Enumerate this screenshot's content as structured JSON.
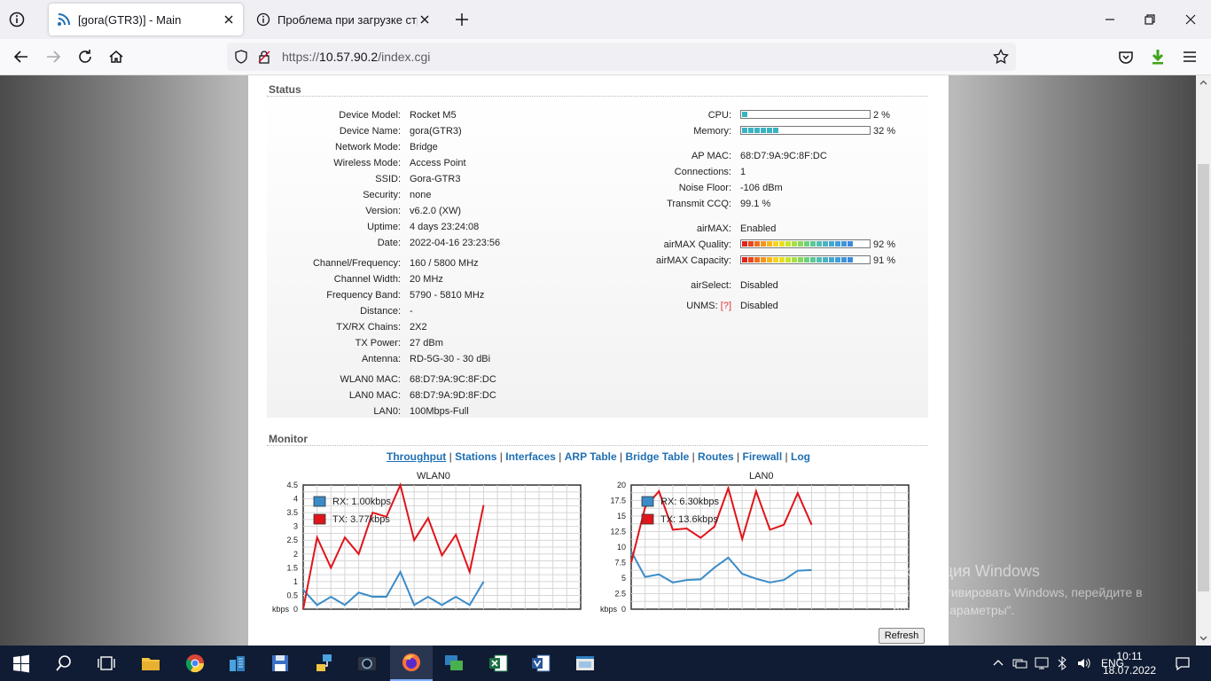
{
  "browser": {
    "tabs": [
      {
        "title": "[gora(GTR3)] - Main",
        "active": true
      },
      {
        "title": "Проблема при загрузке стран",
        "active": false
      }
    ],
    "url_prefix": "https://",
    "url_host": "10.57.90.2",
    "url_path": "/index.cgi"
  },
  "status": {
    "title": "Status",
    "left": [
      {
        "label": "Device Model:",
        "value": "Rocket M5"
      },
      {
        "label": "Device Name:",
        "value": "gora(GTR3)"
      },
      {
        "label": "Network Mode:",
        "value": "Bridge"
      },
      {
        "label": "Wireless Mode:",
        "value": "Access Point"
      },
      {
        "label": "SSID:",
        "value": "Gora-GTR3"
      },
      {
        "label": "Security:",
        "value": "none"
      },
      {
        "label": "Version:",
        "value": "v6.2.0 (XW)"
      },
      {
        "label": "Uptime:",
        "value": "4 days 23:24:08"
      },
      {
        "label": "Date:",
        "value": "2022-04-16 23:23:56"
      },
      {
        "label": "Channel/Frequency:",
        "value": "160 / 5800 MHz"
      },
      {
        "label": "Channel Width:",
        "value": "20 MHz"
      },
      {
        "label": "Frequency Band:",
        "value": "5790 - 5810 MHz"
      },
      {
        "label": "Distance:",
        "value": "-"
      },
      {
        "label": "TX/RX Chains:",
        "value": "2X2"
      },
      {
        "label": "TX Power:",
        "value": "27 dBm"
      },
      {
        "label": "Antenna:",
        "value": "RD-5G-30 - 30 dBi"
      },
      {
        "label": "WLAN0 MAC:",
        "value": "68:D7:9A:9C:8F:DC"
      },
      {
        "label": "LAN0 MAC:",
        "value": "68:D7:9A:9D:8F:DC"
      },
      {
        "label": "LAN0:",
        "value": "100Mbps-Full"
      }
    ],
    "cpu": {
      "label": "CPU:",
      "value": "2 %",
      "percent": 2
    },
    "memory": {
      "label": "Memory:",
      "value": "32 %",
      "percent": 32
    },
    "right": [
      {
        "label": "AP MAC:",
        "value": "68:D7:9A:9C:8F:DC"
      },
      {
        "label": "Connections:",
        "value": "1"
      },
      {
        "label": "Noise Floor:",
        "value": "-106 dBm"
      },
      {
        "label": "Transmit CCQ:",
        "value": "99.1 %"
      },
      {
        "label": "airMAX:",
        "value": "Enabled"
      }
    ],
    "airmax_quality": {
      "label": "airMAX Quality:",
      "value": "92 %",
      "percent": 92
    },
    "airmax_capacity": {
      "label": "airMAX Capacity:",
      "value": "91 %",
      "percent": 91
    },
    "airselect": {
      "label": "airSelect:",
      "value": "Disabled"
    },
    "unms": {
      "label": "UNMS:",
      "help": "[?]",
      "value": "Disabled"
    }
  },
  "monitor": {
    "title": "Monitor",
    "links": [
      "Throughput",
      "Stations",
      "Interfaces",
      "ARP Table",
      "Bridge Table",
      "Routes",
      "Firewall",
      "Log"
    ],
    "current_link": "Throughput",
    "refresh_label": "Refresh"
  },
  "chart_data": [
    {
      "type": "line",
      "title": "WLAN0",
      "ylabel": "kbps",
      "ylim": [
        0,
        4.5
      ],
      "yticks": [
        "4.5",
        "4",
        "3.5",
        "3",
        "2.5",
        "2",
        "1.5",
        "1",
        "0.5",
        "0"
      ],
      "series": [
        {
          "name": "RX: 1.00kbps",
          "color": "#3a8cc8",
          "values": [
            0.7,
            0.15,
            0.45,
            0.15,
            0.6,
            0.45,
            0.45,
            1.35,
            0.15,
            0.45,
            0.15,
            0.45,
            0.15,
            1.0
          ]
        },
        {
          "name": "TX: 3.77kbps",
          "color": "#e0151b",
          "values": [
            0.0,
            2.6,
            1.5,
            2.6,
            2.0,
            3.5,
            3.35,
            4.5,
            2.5,
            3.3,
            1.95,
            2.7,
            1.35,
            3.77
          ]
        }
      ]
    },
    {
      "type": "line",
      "title": "LAN0",
      "ylabel": "kbps",
      "ylim": [
        0,
        20
      ],
      "yticks": [
        "20",
        "17.5",
        "15",
        "12.5",
        "10",
        "7.5",
        "5",
        "2.5",
        "0"
      ],
      "series": [
        {
          "name": "RX: 6.30kbps",
          "color": "#3a8cc8",
          "values": [
            9.3,
            5.2,
            5.6,
            4.3,
            4.7,
            4.8,
            6.7,
            8.3,
            5.7,
            4.9,
            4.3,
            4.7,
            6.2,
            6.3
          ]
        },
        {
          "name": "TX: 13.6kbps",
          "color": "#e0151b",
          "values": [
            7.5,
            16.4,
            19.0,
            12.8,
            13.0,
            11.5,
            13.3,
            19.5,
            11.3,
            19.0,
            12.8,
            13.6,
            18.7,
            13.6
          ]
        }
      ]
    }
  ],
  "watermark": {
    "title": "Активация Windows",
    "text": "Чтобы активировать Windows, перейдите в раздел \"Параметры\"."
  },
  "taskbar": {
    "language": "ENG",
    "time": "10:11",
    "date": "18.07.2022"
  }
}
